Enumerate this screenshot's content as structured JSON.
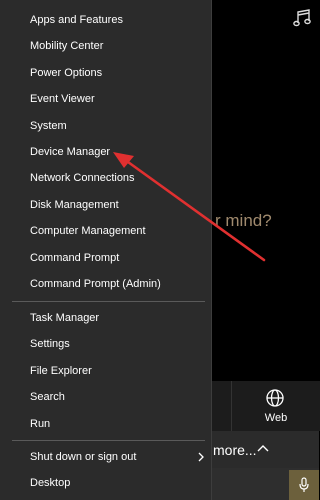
{
  "menu": {
    "groups": [
      [
        "Apps and Features",
        "Mobility Center",
        "Power Options",
        "Event Viewer",
        "System",
        "Device Manager",
        "Network Connections",
        "Disk Management",
        "Computer Management",
        "Command Prompt",
        "Command Prompt (Admin)"
      ],
      [
        "Task Manager",
        "Settings",
        "File Explorer",
        "Search",
        "Run"
      ],
      [
        "Shut down or sign out",
        "Desktop"
      ]
    ]
  },
  "background": {
    "prompt_text": "r mind?",
    "web_label": "Web",
    "more_label": "more..."
  },
  "colors": {
    "menu_bg": "#2b2b2b",
    "annotation": "#e03030",
    "prompt_text": "#a08a6e",
    "mic_bg": "#6c603c"
  }
}
